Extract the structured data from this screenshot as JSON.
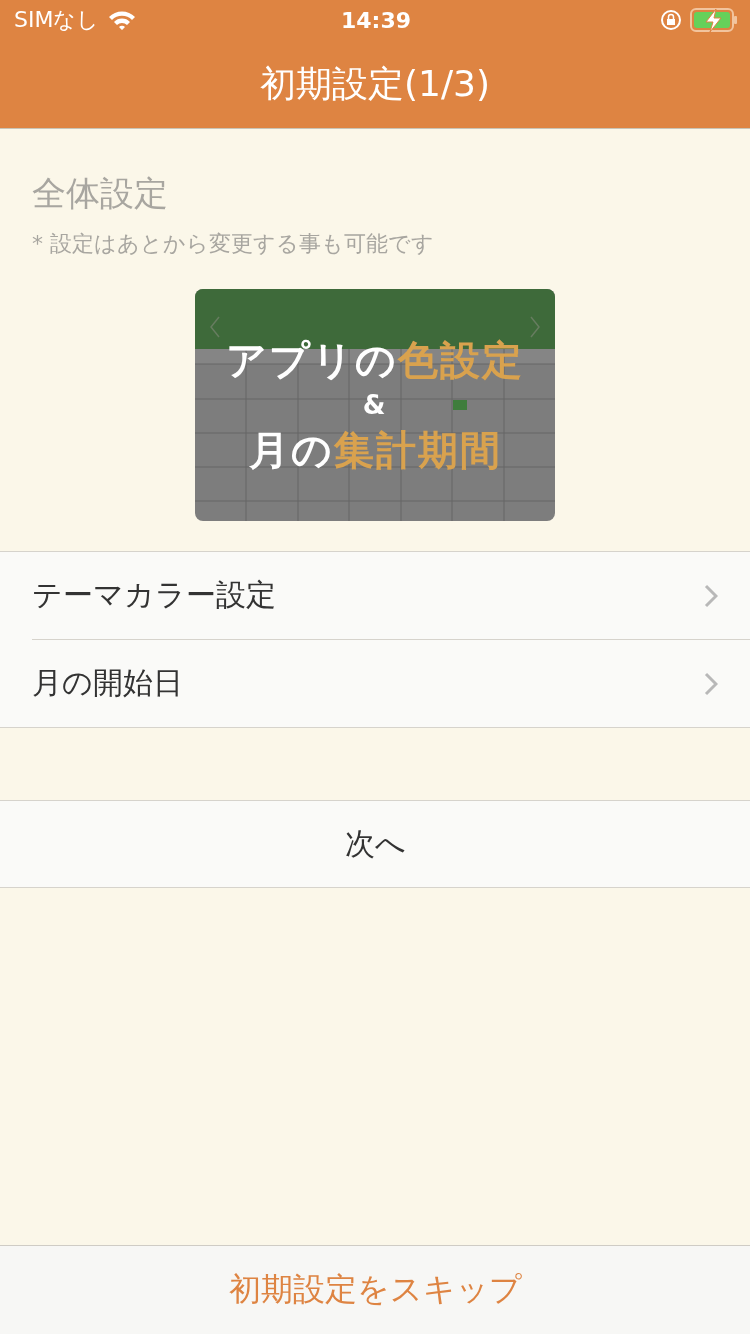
{
  "status_bar": {
    "carrier": "SIMなし",
    "time": "14:39",
    "charging": true
  },
  "nav": {
    "title": "初期設定(1/3)"
  },
  "section": {
    "title": "全体設定",
    "note": "* 設定はあとから変更する事も可能です"
  },
  "banner": {
    "kind": "picture",
    "headline": [
      [
        {
          "text": "アプリの",
          "accent": false
        },
        {
          "text": "色設定",
          "accent": true
        }
      ],
      [
        {
          "text": "&",
          "accent": false
        }
      ],
      [
        {
          "text": "月の",
          "accent": false
        },
        {
          "text": "集計期間",
          "accent": true
        }
      ]
    ]
  },
  "menu": [
    {
      "label": "テーマカラー設定"
    },
    {
      "label": "月の開始日"
    }
  ],
  "next_button": "次へ",
  "skip_button": "初期設定をスキップ"
}
